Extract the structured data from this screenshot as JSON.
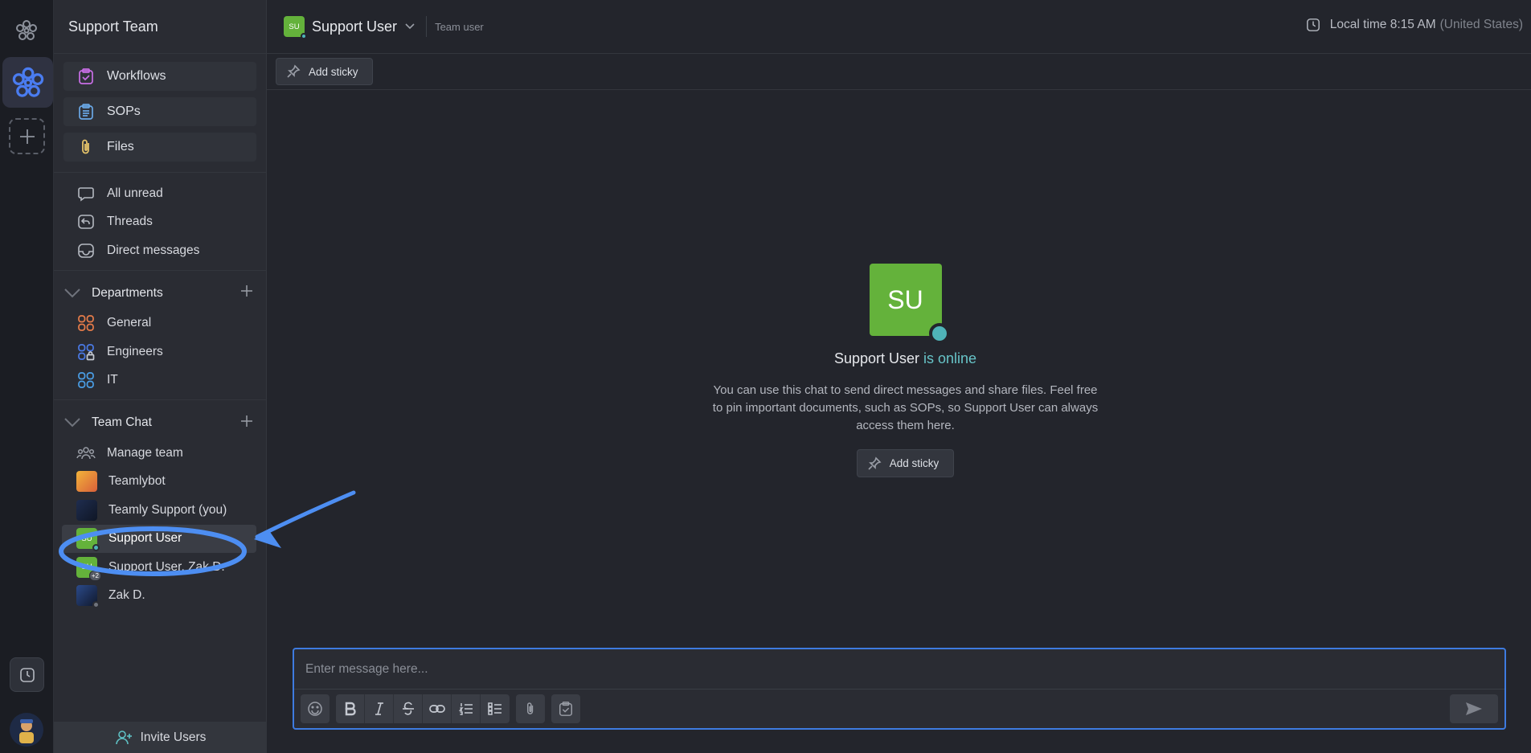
{
  "sidebar": {
    "team_name": "Support Team",
    "pinned": [
      {
        "label": "Workflows",
        "icon": "workflow-icon",
        "color": "#c86ee6"
      },
      {
        "label": "SOPs",
        "icon": "sop-list-icon",
        "color": "#6aa8e6"
      },
      {
        "label": "Files",
        "icon": "paperclip-icon",
        "color": "#e6c46a"
      }
    ],
    "nav": [
      {
        "label": "All unread",
        "icon": "chat-bubble-icon"
      },
      {
        "label": "Threads",
        "icon": "threads-icon"
      },
      {
        "label": "Direct messages",
        "icon": "inbox-icon"
      }
    ],
    "departments": {
      "title": "Departments",
      "items": [
        {
          "label": "General",
          "icon": "channel-grid-icon",
          "color": "#e67c4a"
        },
        {
          "label": "Engineers",
          "icon": "channel-lock-icon",
          "color": "#4a7ae6"
        },
        {
          "label": "IT",
          "icon": "channel-grid-icon",
          "color": "#4a9ee6"
        }
      ]
    },
    "team_chat": {
      "title": "Team Chat",
      "manage_label": "Manage team",
      "members": [
        {
          "label": "Teamlybot",
          "initials": "",
          "status": "none"
        },
        {
          "label": "Teamly Support (you)",
          "initials": "",
          "status": "none"
        },
        {
          "label": "Support User",
          "initials": "SU",
          "status": "online"
        },
        {
          "label": "Support User, Zak D.",
          "initials": "SU",
          "status": "group",
          "badge": "+2"
        },
        {
          "label": "Zak D.",
          "initials": "",
          "status": "offline"
        }
      ]
    },
    "invite_label": "Invite Users"
  },
  "header": {
    "avatar_initials": "SU",
    "name": "Support User",
    "role": "Team user",
    "local_time_label": "Local time 8:15 AM",
    "country": "(United States)"
  },
  "sticky_button_label": "Add sticky",
  "intro": {
    "avatar_initials": "SU",
    "name": "Support User",
    "status_text": "is online",
    "description": "You can use this chat to send direct messages and share files. Feel free to pin important documents, such as SOPs, so Support User can always access them here.",
    "button_label": "Add sticky"
  },
  "composer": {
    "placeholder": "Enter message here..."
  },
  "colors": {
    "accent": "#3e7be0",
    "online": "#4fb3b8",
    "avatar_green": "#64b23b"
  }
}
